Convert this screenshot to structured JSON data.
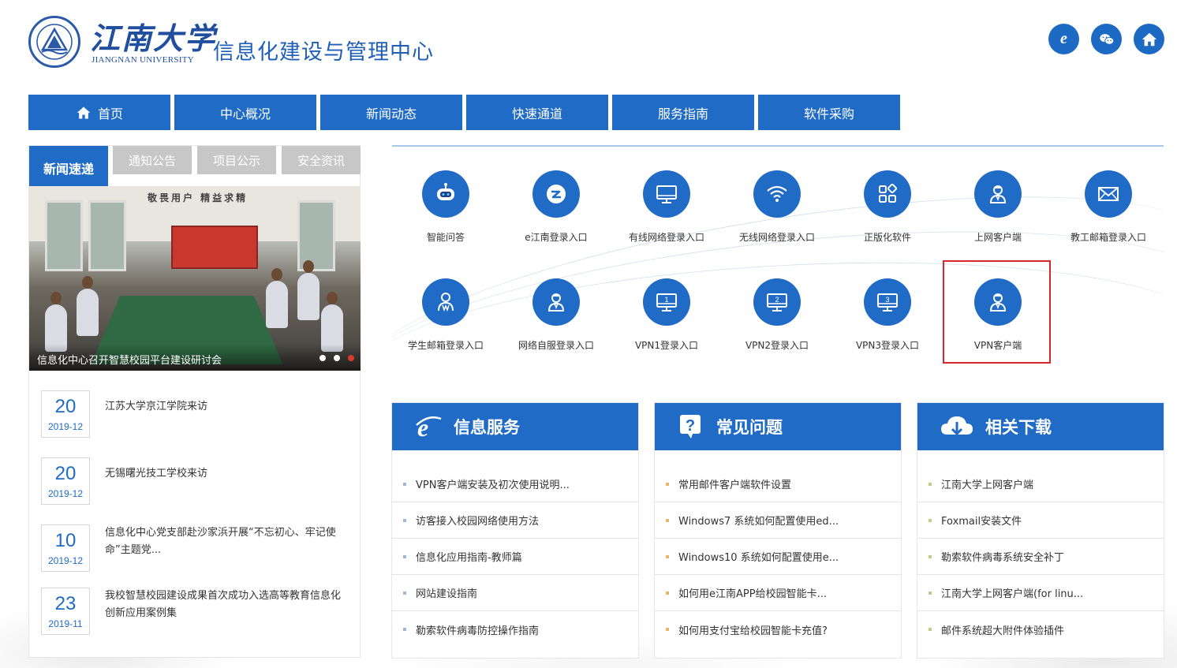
{
  "header": {
    "logo_cn": "江南大学",
    "logo_en": "JIANGNAN UNIVERSITY",
    "site_title": "信息化建设与管理中心",
    "top_icons": [
      {
        "name": "e-icon",
        "glyph": "e"
      },
      {
        "name": "wechat-icon"
      },
      {
        "name": "home-icon"
      }
    ]
  },
  "nav": {
    "items": [
      {
        "label": "首页",
        "icon": "home-icon"
      },
      {
        "label": "中心概况"
      },
      {
        "label": "新闻动态"
      },
      {
        "label": "快速通道"
      },
      {
        "label": "服务指南"
      },
      {
        "label": "软件采购"
      }
    ]
  },
  "news": {
    "tabs": [
      "新闻速递",
      "通知公告",
      "项目公示",
      "安全资讯"
    ],
    "active_tab": 0,
    "slide": {
      "banner": "敬畏用户 精益求精",
      "caption": "信息化中心召开智慧校园平台建设研讨会",
      "dots": 3,
      "active_dot": 2
    },
    "items": [
      {
        "day": "20",
        "ym": "2019-12",
        "title": "江苏大学京江学院来访"
      },
      {
        "day": "20",
        "ym": "2019-12",
        "title": "无锡曙光技工学校来访"
      },
      {
        "day": "10",
        "ym": "2019-12",
        "title": "信息化中心党支部赴沙家浜开展“不忘初心、牢记使命”主题党..."
      },
      {
        "day": "23",
        "ym": "2019-11",
        "title": "我校智慧校园建设成果首次成功入选高等教育信息化创新应用案例集"
      }
    ]
  },
  "services": {
    "items": [
      {
        "label": "智能问答",
        "icon": "robot-icon"
      },
      {
        "label": "e江南登录入口",
        "icon": "e-jiangnan-icon"
      },
      {
        "label": "有线网络登录入口",
        "icon": "monitor-icon"
      },
      {
        "label": "无线网络登录入口",
        "icon": "wifi-icon"
      },
      {
        "label": "正版化软件",
        "icon": "apps-icon"
      },
      {
        "label": "上网客户端",
        "icon": "user-icon"
      },
      {
        "label": "教工邮箱登录入口",
        "icon": "mail-icon"
      },
      {
        "label": "学生邮箱登录入口",
        "icon": "student-icon"
      },
      {
        "label": "网络自服登录入口",
        "icon": "user-icon"
      },
      {
        "label": "VPN1登录入口",
        "icon": "monitor-1-icon",
        "num": "1"
      },
      {
        "label": "VPN2登录入口",
        "icon": "monitor-2-icon",
        "num": "2"
      },
      {
        "label": "VPN3登录入口",
        "icon": "monitor-3-icon",
        "num": "3"
      },
      {
        "label": "VPN客户端",
        "icon": "user-icon"
      }
    ]
  },
  "cards": [
    {
      "title": "信息服务",
      "icon": "ie-icon",
      "bullet_color": "#9fb9d6",
      "rows": [
        "VPN客户端安装及初次使用说明...",
        "访客接入校园网络使用方法",
        "信息化应用指南-教师篇",
        "网站建设指南",
        "勒索软件病毒防控操作指南"
      ]
    },
    {
      "title": "常见问题",
      "icon": "question-icon",
      "bullet_color": "#e8b56a",
      "rows": [
        "常用邮件客户端软件设置",
        "Windows7 系统如何配置使用ed...",
        "Windows10 系统如何配置使用e...",
        "如何用e江南APP给校园智能卡...",
        "如何用支付宝给校园智能卡充值?"
      ]
    },
    {
      "title": "相关下载",
      "icon": "cloud-download-icon",
      "bullet_color": "#b9d08a",
      "rows": [
        "江南大学上网客户端",
        "Foxmail安装文件",
        "勒索软件病毒系统安全补丁",
        "江南大学上网客户端(for linu...",
        "邮件系统超大附件体验插件"
      ]
    }
  ],
  "colors": {
    "primary": "#1f6bc6",
    "tab_inactive": "#c7c7c7",
    "highlight": "#d7262c"
  }
}
